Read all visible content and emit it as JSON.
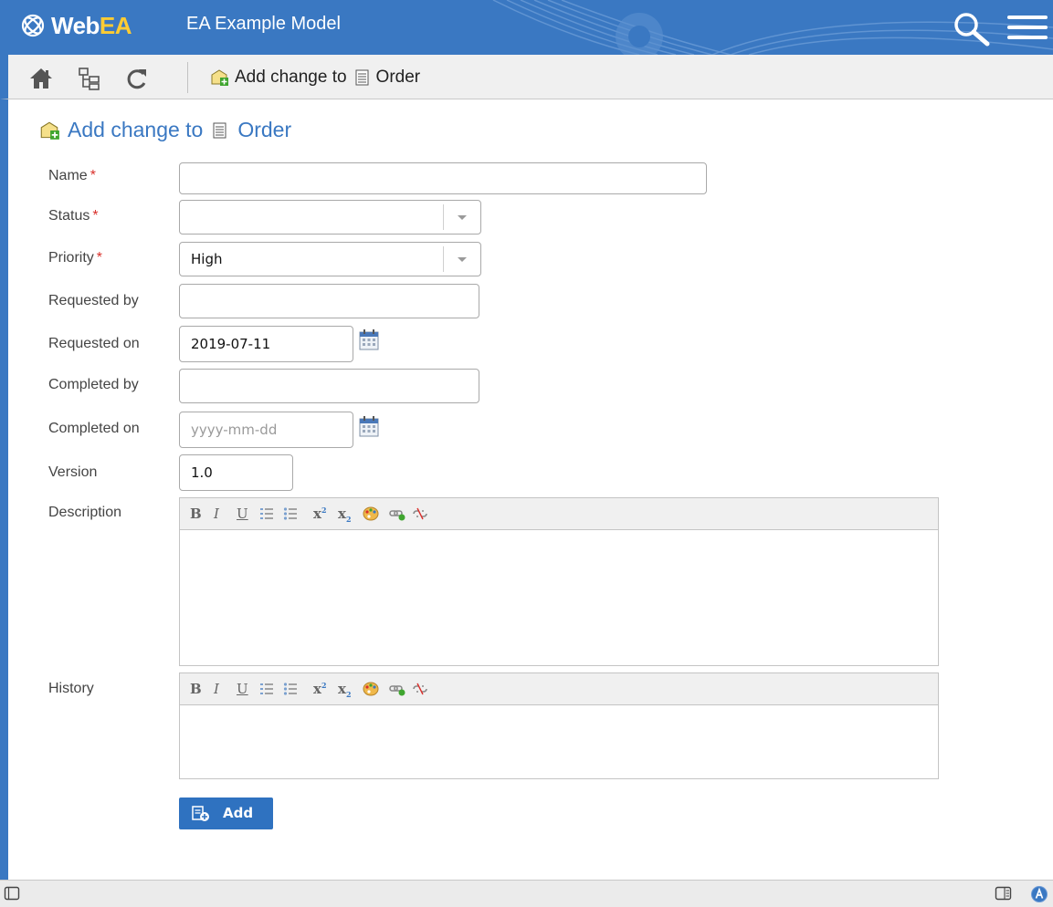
{
  "app": {
    "logo_prefix": "Web",
    "logo_suffix": "EA",
    "model_title": "EA Example Model",
    "accent_color": "#3a78c2"
  },
  "toolbar": {
    "breadcrumb_action": "Add change to",
    "breadcrumb_target": "Order",
    "icons": [
      "home-icon",
      "tree-icon",
      "refresh-icon"
    ]
  },
  "page": {
    "title_action": "Add change to",
    "title_target": "Order"
  },
  "form": {
    "name": {
      "label": "Name",
      "required_mark": "*",
      "value": ""
    },
    "status": {
      "label": "Status",
      "required_mark": "*",
      "value": ""
    },
    "priority": {
      "label": "Priority",
      "required_mark": "*",
      "value": "High"
    },
    "requested_by": {
      "label": "Requested by",
      "value": ""
    },
    "requested_on": {
      "label": "Requested on",
      "value": "2019-07-11"
    },
    "completed_by": {
      "label": "Completed by",
      "value": ""
    },
    "completed_on": {
      "label": "Completed on",
      "value": "",
      "placeholder": "yyyy-mm-dd"
    },
    "version": {
      "label": "Version",
      "value": "1.0"
    },
    "description": {
      "label": "Description"
    },
    "history": {
      "label": "History"
    }
  },
  "editor_toolbar": {
    "bold": "B",
    "italic": "I",
    "underline": "U",
    "superscript": "x",
    "subscript": "x",
    "superscript_mark": "2",
    "subscript_mark": "2"
  },
  "add_button": {
    "label": "Add"
  }
}
